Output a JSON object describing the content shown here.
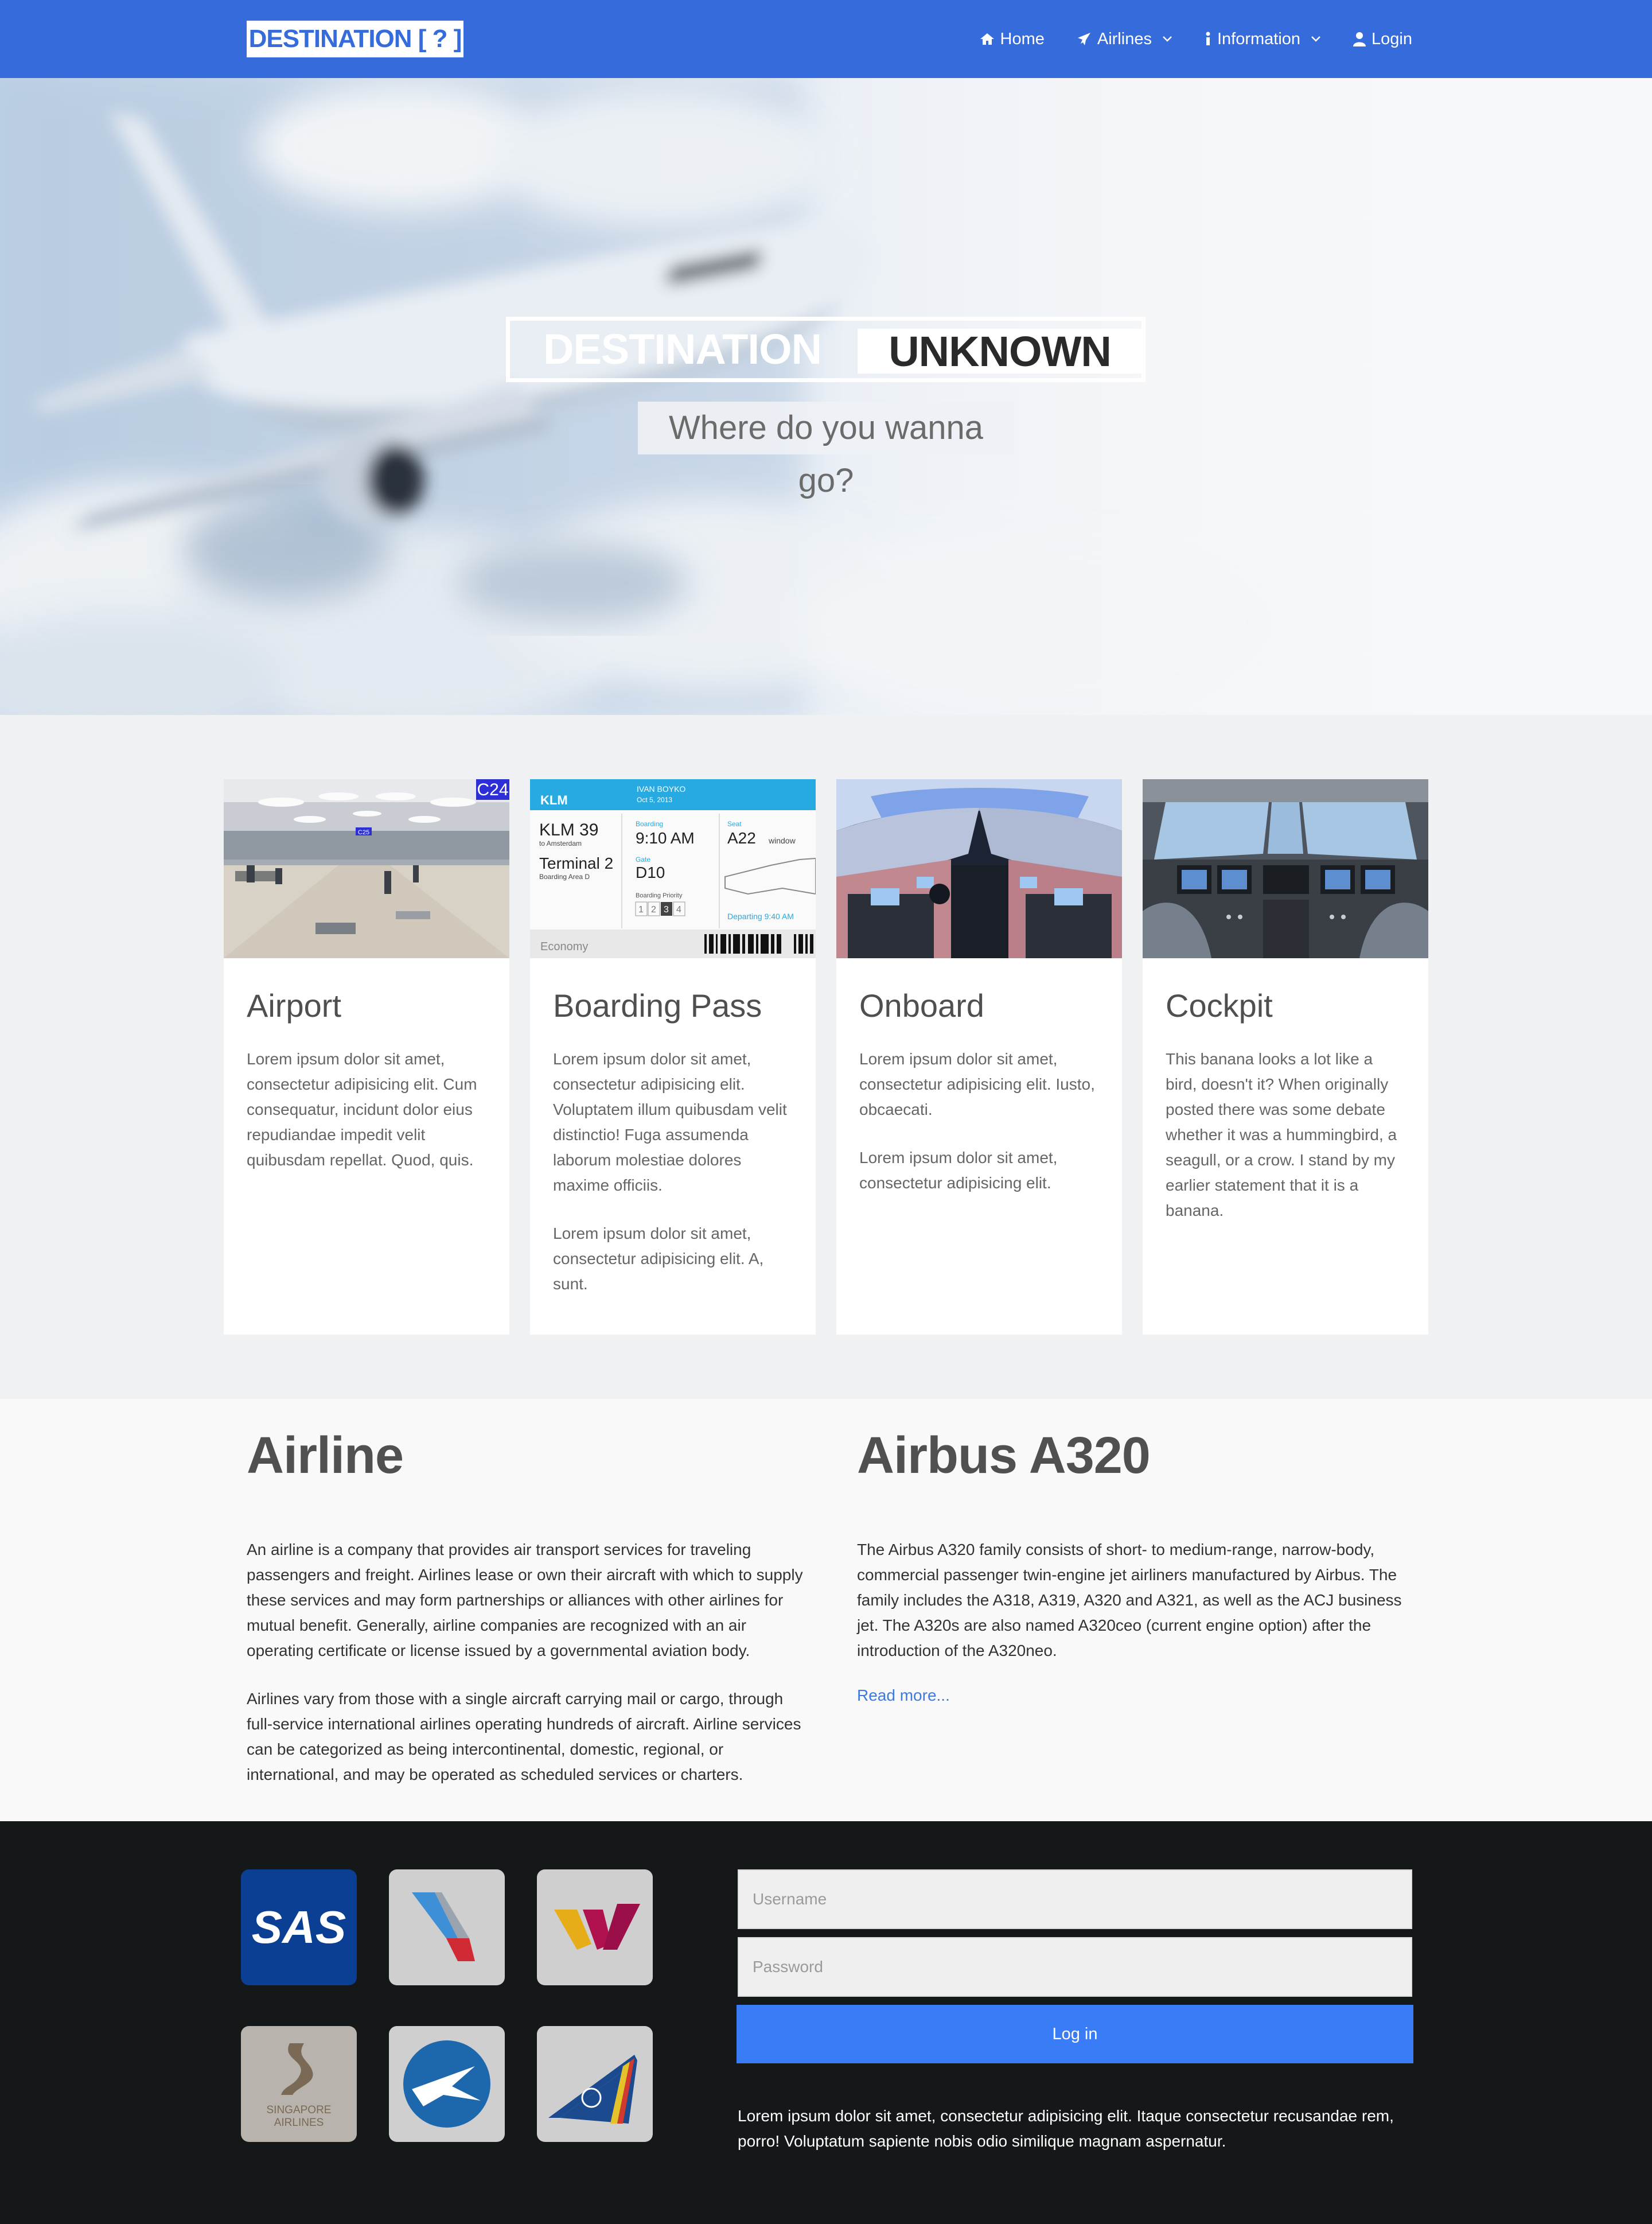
{
  "navbar": {
    "brand": "DESTINATION [ ? ]",
    "links": [
      {
        "label": "Home",
        "icon": "home-icon"
      },
      {
        "label": "Airlines",
        "icon": "plane-icon"
      },
      {
        "label": "Information",
        "icon": "info-icon"
      },
      {
        "label": "Login",
        "icon": "user-icon"
      }
    ]
  },
  "hero": {
    "title_part1": "DESTINATION",
    "title_part2": "UNKNOWN",
    "subtitle": "Where do you wanna go?"
  },
  "cards": [
    {
      "title": "Airport",
      "paragraphs": [
        "Lorem ipsum dolor sit amet, consectetur adipisicing elit. Cum consequatur, incidunt dolor eius repudiandae impedit velit quibusdam repellat. Quod, quis."
      ],
      "image_labels": {
        "gate": "C24",
        "gate2": "C25"
      }
    },
    {
      "title": "Boarding Pass",
      "paragraphs": [
        "Lorem ipsum dolor sit amet, consectetur adipisicing elit. Voluptatem illum quibusdam velit distinctio! Fuga assumenda laborum molestiae dolores maxime officiis.",
        "Lorem ipsum dolor sit amet, consectetur adipisicing elit. A, sunt."
      ],
      "image_labels": {
        "airline": "KLM",
        "passenger": "IVAN BOYKO",
        "date": "Oct 5, 2013",
        "flight": "KLM 39",
        "destination": "to Amsterdam",
        "terminal": "Terminal 2",
        "area": "Boarding Area D",
        "boarding_label": "Boarding",
        "boarding_time": "9:10 AM",
        "seat_label": "Seat",
        "seat": "A22",
        "seat_type": "window",
        "gate_label": "Gate",
        "gate": "D10",
        "priority_label": "Boarding Priority",
        "priority": [
          "1",
          "2",
          "3",
          "4"
        ],
        "departing": "Departing 9:40 AM",
        "class": "Economy"
      }
    },
    {
      "title": "Onboard",
      "paragraphs": [
        "Lorem ipsum dolor sit amet, consectetur adipisicing elit. Iusto, obcaecati.",
        "Lorem ipsum dolor sit amet, consectetur adipisicing elit."
      ]
    },
    {
      "title": "Cockpit",
      "paragraphs": [
        "This banana looks a lot like a bird, doesn't it? When originally posted there was some debate whether it was a hummingbird, a seagull, or a crow. I stand by my earlier statement that it is a banana."
      ]
    }
  ],
  "info": {
    "airline": {
      "title": "Airline",
      "p1": "An airline is a company that provides air transport services for traveling passengers and freight. Airlines lease or own their aircraft with which to supply these services and may form partnerships or alliances with other airlines for mutual benefit. Generally, airline companies are recognized with an air operating certificate or license issued by a governmental aviation body.",
      "p2": "Airlines vary from those with a single aircraft carrying mail or cargo, through full-service international airlines operating hundreds of aircraft. Airline services can be categorized as being intercontinental, domestic, regional, or international, and may be operated as scheduled services or charters."
    },
    "a320": {
      "title": "Airbus A320",
      "p1": "The Airbus A320 family consists of short- to medium-range, narrow-body, commercial passenger twin-engine jet airliners manufactured by Airbus. The family includes the A318, A319, A320 and A321, as well as the ACJ business jet. The A320s are also named A320ceo (current engine option) after the introduction of the A320neo.",
      "link": "Read more..."
    }
  },
  "footer": {
    "logos": [
      {
        "name": "sas-logo",
        "text": "SAS"
      },
      {
        "name": "american-airlines-logo"
      },
      {
        "name": "germanwings-logo"
      },
      {
        "name": "singapore-airlines-logo",
        "text": "SINGAPORE AIRLINES"
      },
      {
        "name": "aeromexico-logo"
      },
      {
        "name": "lot-logo"
      }
    ],
    "username_placeholder": "Username",
    "password_placeholder": "Password",
    "login_label": "Log in",
    "text": "Lorem ipsum dolor sit amet, consectetur adipisicing elit. Itaque consectetur recusandae rem, porro! Voluptatum sapiente nobis odio similique magnam aspernatur."
  },
  "colors": {
    "primary": "#356bda",
    "button": "#3a7cf5",
    "footer_bg": "#141819",
    "link": "#3d7ae0"
  }
}
